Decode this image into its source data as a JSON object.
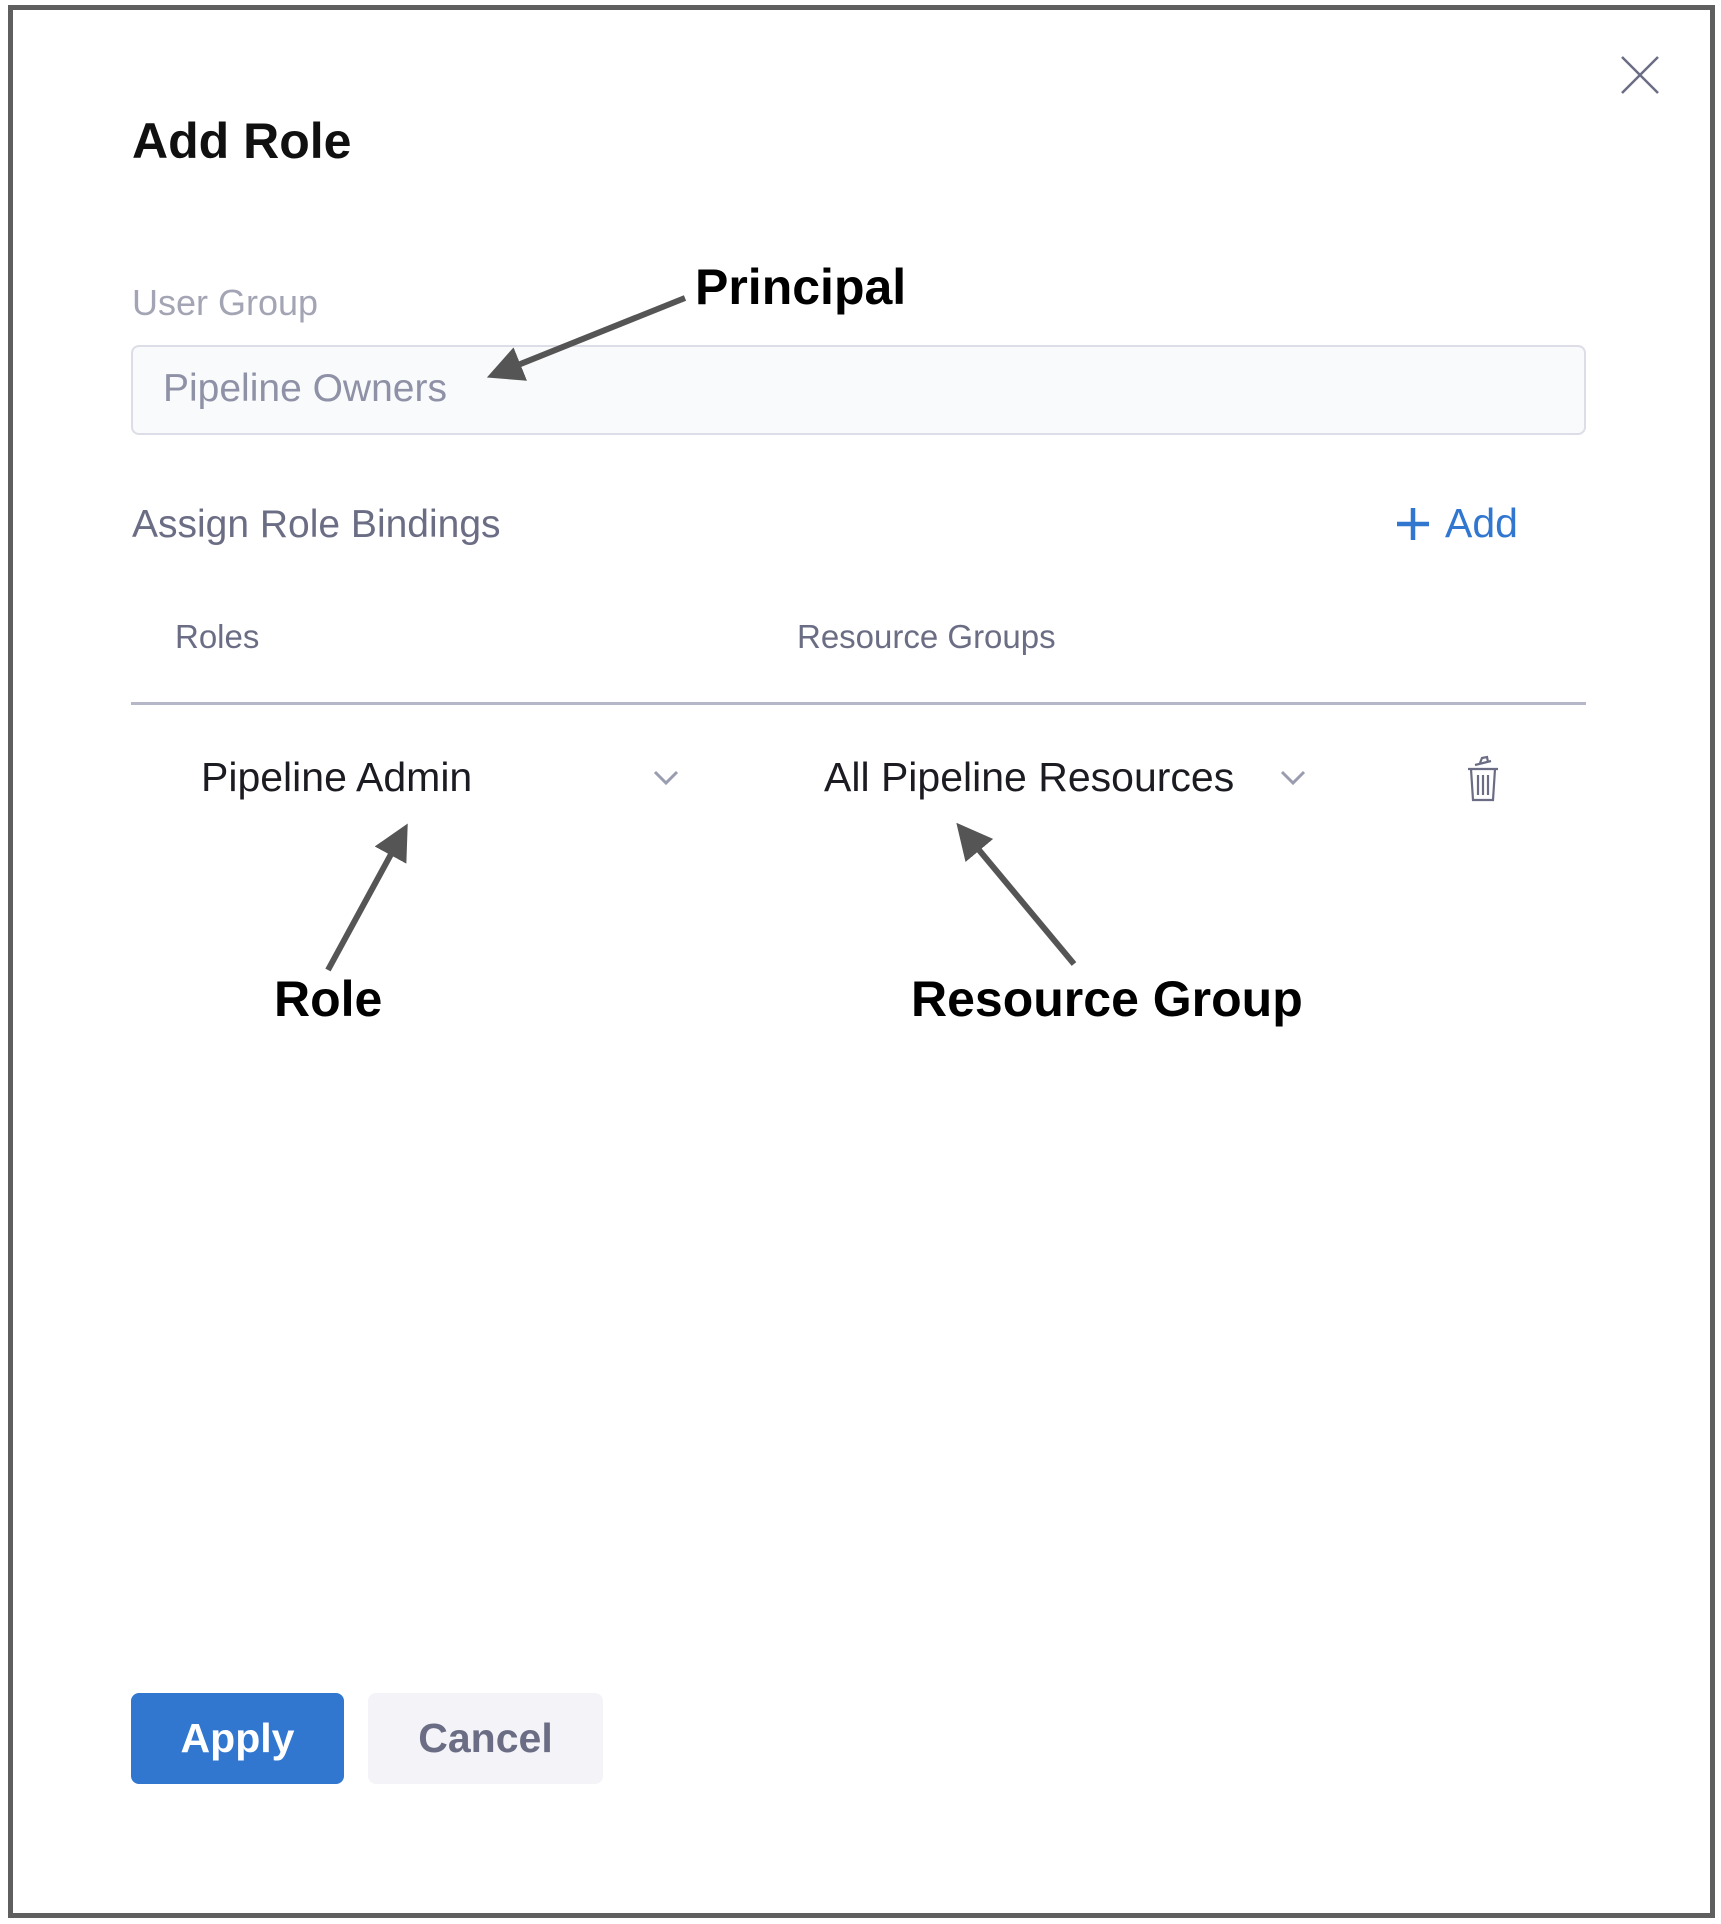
{
  "dialog": {
    "title": "Add Role",
    "close_icon": "close-icon",
    "user_group": {
      "label": "User Group",
      "value": "Pipeline Owners"
    },
    "bindings": {
      "section_title": "Assign Role Bindings",
      "add_label": "Add",
      "columns": [
        "Roles",
        "Resource Groups"
      ],
      "rows": [
        {
          "role": "Pipeline Admin",
          "resource_group": "All Pipeline Resources"
        }
      ]
    },
    "buttons": {
      "apply": "Apply",
      "cancel": "Cancel"
    },
    "accent_color": "#3177d0"
  },
  "annotations": {
    "principal": "Principal",
    "role": "Role",
    "resource_group": "Resource Group"
  }
}
